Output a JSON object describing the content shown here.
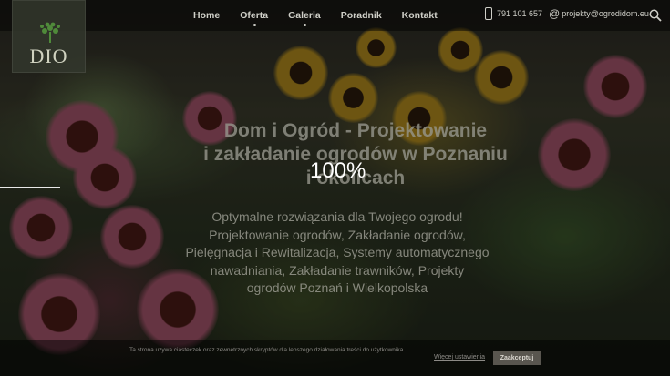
{
  "header": {
    "logo_text": "DIO",
    "nav": [
      {
        "label": "Home"
      },
      {
        "label": "Oferta"
      },
      {
        "label": "Galeria"
      },
      {
        "label": "Poradnik"
      },
      {
        "label": "Kontakt"
      }
    ],
    "phone": "791 101 657",
    "email": "projekty@ogrodidom.eu"
  },
  "hero": {
    "title_line1": "Dom i Ogród - Projektowanie",
    "title_line2": "i zakładanie ogrodów w Poznaniu",
    "title_line3": "i okolicach",
    "subtitle_line1": "Optymalne rozwiązania dla Twojego ogrodu!",
    "subtitle_line2": "Projektowanie ogrodów, Zakładanie ogrodów,",
    "subtitle_line3": "Pielęgnacja i Rewitalizacja, Systemy automatycznego",
    "subtitle_line4": "nawadniania, Zakładanie trawników, Projekty",
    "subtitle_line5": "ogrodów Poznań i Wielkopolska"
  },
  "loader": {
    "percent_text": "100%",
    "progress": 1.0
  },
  "cookie": {
    "text": "Ta strona używa ciasteczek oraz zewnętrznych skryptów dla lepszego działowania treści do użytkownika",
    "more_label": "Więcej ustawienia",
    "accept_label": "Zaakceptuj"
  },
  "colors": {
    "nav_text": "#cfcfc8",
    "overlay": "#000000"
  }
}
